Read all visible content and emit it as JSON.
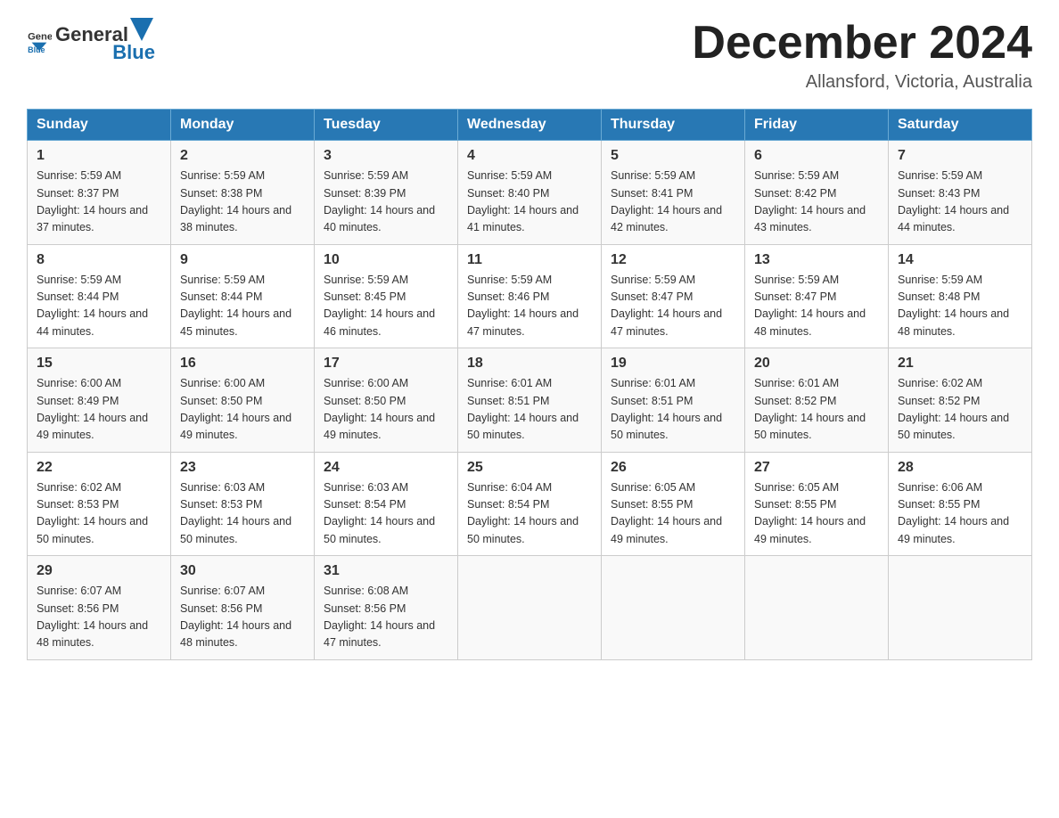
{
  "header": {
    "logo_general": "General",
    "logo_blue": "Blue",
    "title": "December 2024",
    "location": "Allansford, Victoria, Australia"
  },
  "days_of_week": [
    "Sunday",
    "Monday",
    "Tuesday",
    "Wednesday",
    "Thursday",
    "Friday",
    "Saturday"
  ],
  "weeks": [
    [
      {
        "day": "1",
        "sunrise": "5:59 AM",
        "sunset": "8:37 PM",
        "daylight": "14 hours and 37 minutes."
      },
      {
        "day": "2",
        "sunrise": "5:59 AM",
        "sunset": "8:38 PM",
        "daylight": "14 hours and 38 minutes."
      },
      {
        "day": "3",
        "sunrise": "5:59 AM",
        "sunset": "8:39 PM",
        "daylight": "14 hours and 40 minutes."
      },
      {
        "day": "4",
        "sunrise": "5:59 AM",
        "sunset": "8:40 PM",
        "daylight": "14 hours and 41 minutes."
      },
      {
        "day": "5",
        "sunrise": "5:59 AM",
        "sunset": "8:41 PM",
        "daylight": "14 hours and 42 minutes."
      },
      {
        "day": "6",
        "sunrise": "5:59 AM",
        "sunset": "8:42 PM",
        "daylight": "14 hours and 43 minutes."
      },
      {
        "day": "7",
        "sunrise": "5:59 AM",
        "sunset": "8:43 PM",
        "daylight": "14 hours and 44 minutes."
      }
    ],
    [
      {
        "day": "8",
        "sunrise": "5:59 AM",
        "sunset": "8:44 PM",
        "daylight": "14 hours and 44 minutes."
      },
      {
        "day": "9",
        "sunrise": "5:59 AM",
        "sunset": "8:44 PM",
        "daylight": "14 hours and 45 minutes."
      },
      {
        "day": "10",
        "sunrise": "5:59 AM",
        "sunset": "8:45 PM",
        "daylight": "14 hours and 46 minutes."
      },
      {
        "day": "11",
        "sunrise": "5:59 AM",
        "sunset": "8:46 PM",
        "daylight": "14 hours and 47 minutes."
      },
      {
        "day": "12",
        "sunrise": "5:59 AM",
        "sunset": "8:47 PM",
        "daylight": "14 hours and 47 minutes."
      },
      {
        "day": "13",
        "sunrise": "5:59 AM",
        "sunset": "8:47 PM",
        "daylight": "14 hours and 48 minutes."
      },
      {
        "day": "14",
        "sunrise": "5:59 AM",
        "sunset": "8:48 PM",
        "daylight": "14 hours and 48 minutes."
      }
    ],
    [
      {
        "day": "15",
        "sunrise": "6:00 AM",
        "sunset": "8:49 PM",
        "daylight": "14 hours and 49 minutes."
      },
      {
        "day": "16",
        "sunrise": "6:00 AM",
        "sunset": "8:50 PM",
        "daylight": "14 hours and 49 minutes."
      },
      {
        "day": "17",
        "sunrise": "6:00 AM",
        "sunset": "8:50 PM",
        "daylight": "14 hours and 49 minutes."
      },
      {
        "day": "18",
        "sunrise": "6:01 AM",
        "sunset": "8:51 PM",
        "daylight": "14 hours and 50 minutes."
      },
      {
        "day": "19",
        "sunrise": "6:01 AM",
        "sunset": "8:51 PM",
        "daylight": "14 hours and 50 minutes."
      },
      {
        "day": "20",
        "sunrise": "6:01 AM",
        "sunset": "8:52 PM",
        "daylight": "14 hours and 50 minutes."
      },
      {
        "day": "21",
        "sunrise": "6:02 AM",
        "sunset": "8:52 PM",
        "daylight": "14 hours and 50 minutes."
      }
    ],
    [
      {
        "day": "22",
        "sunrise": "6:02 AM",
        "sunset": "8:53 PM",
        "daylight": "14 hours and 50 minutes."
      },
      {
        "day": "23",
        "sunrise": "6:03 AM",
        "sunset": "8:53 PM",
        "daylight": "14 hours and 50 minutes."
      },
      {
        "day": "24",
        "sunrise": "6:03 AM",
        "sunset": "8:54 PM",
        "daylight": "14 hours and 50 minutes."
      },
      {
        "day": "25",
        "sunrise": "6:04 AM",
        "sunset": "8:54 PM",
        "daylight": "14 hours and 50 minutes."
      },
      {
        "day": "26",
        "sunrise": "6:05 AM",
        "sunset": "8:55 PM",
        "daylight": "14 hours and 49 minutes."
      },
      {
        "day": "27",
        "sunrise": "6:05 AM",
        "sunset": "8:55 PM",
        "daylight": "14 hours and 49 minutes."
      },
      {
        "day": "28",
        "sunrise": "6:06 AM",
        "sunset": "8:55 PM",
        "daylight": "14 hours and 49 minutes."
      }
    ],
    [
      {
        "day": "29",
        "sunrise": "6:07 AM",
        "sunset": "8:56 PM",
        "daylight": "14 hours and 48 minutes."
      },
      {
        "day": "30",
        "sunrise": "6:07 AM",
        "sunset": "8:56 PM",
        "daylight": "14 hours and 48 minutes."
      },
      {
        "day": "31",
        "sunrise": "6:08 AM",
        "sunset": "8:56 PM",
        "daylight": "14 hours and 47 minutes."
      },
      null,
      null,
      null,
      null
    ]
  ]
}
